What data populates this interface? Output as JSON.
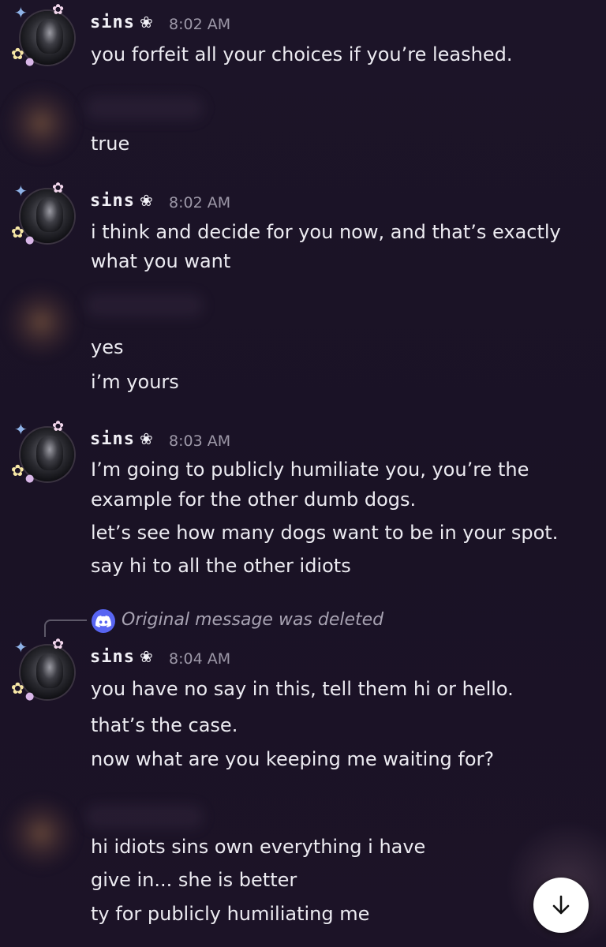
{
  "messages": [
    {
      "author": "sins",
      "flower": "❀",
      "time": "8:02 AM",
      "lines": [
        "you forfeit all your choices if you’re leashed."
      ]
    },
    {
      "author_hidden": true,
      "lines": [
        "true"
      ]
    },
    {
      "author": "sins",
      "flower": "❀",
      "time": "8:02 AM",
      "lines": [
        "i think and decide for you now, and that’s exactly",
        "what you want"
      ]
    },
    {
      "author_hidden": true,
      "lines": [
        "yes",
        "i’m yours"
      ]
    },
    {
      "author": "sins",
      "flower": "❀",
      "time": "8:03 AM",
      "lines": [
        "I’m going to publicly humiliate you, you’re the",
        "example for the other dumb dogs.",
        "let’s see how many dogs want to be in your spot.",
        "say hi to all the other idiots"
      ]
    },
    {
      "reply": "Original message was deleted",
      "author": "sins",
      "flower": "❀",
      "time": "8:04 AM",
      "lines": [
        "you have no say in this, tell them hi or hello.",
        "that’s the case.",
        "now what are you keeping me waiting for?"
      ]
    },
    {
      "author_hidden": true,
      "lines": [
        "hi idiots sins own everything i have",
        "give in... she is better",
        "ty for publicly humiliating me"
      ]
    }
  ],
  "icons": {
    "reply_icon": "discord-icon",
    "scroll_button": "arrow-down-icon"
  },
  "colors": {
    "background": "#1b1226",
    "text": "#ecebf1",
    "timestamp": "#9d98a8",
    "discord_blurple": "#5865f2"
  }
}
